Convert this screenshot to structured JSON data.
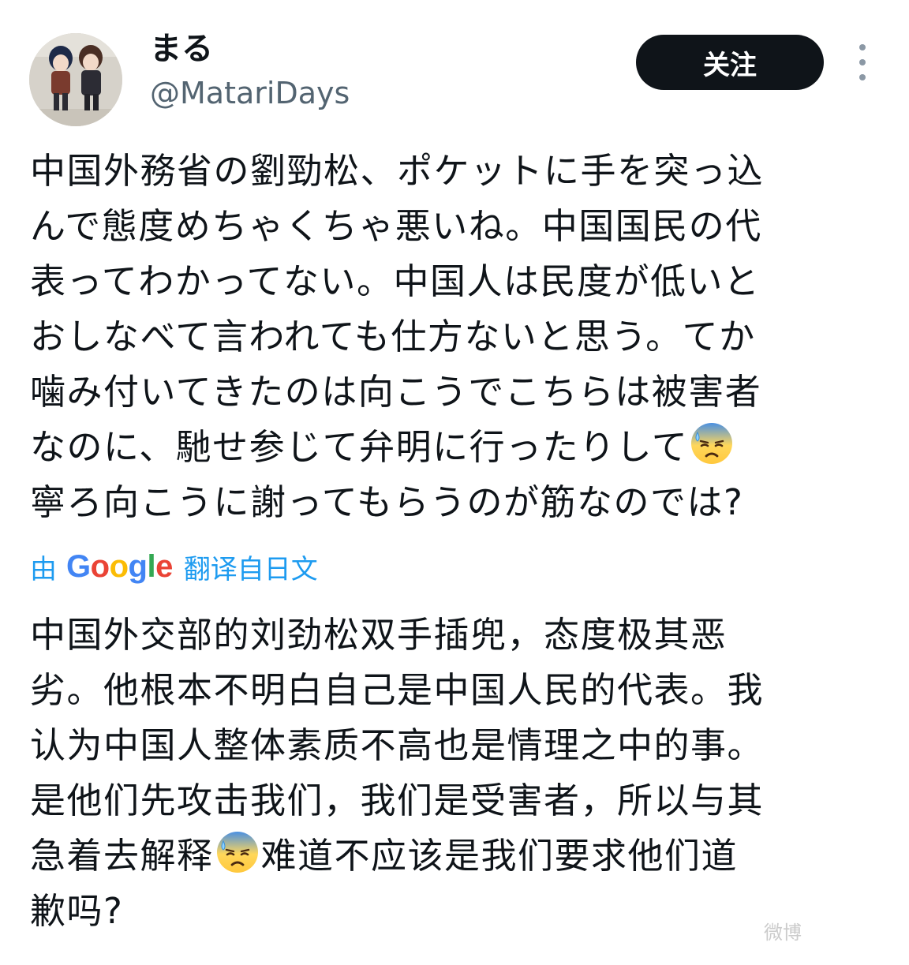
{
  "header": {
    "display_name": "まる",
    "handle": "@MatariDays",
    "follow_label": "关注"
  },
  "post": {
    "lines": [
      "中国外務省の劉勁松、ポケットに手を突っ込",
      "んで態度めちゃくちゃ悪いね。中国国民の代",
      "表ってわかってない。中国人は民度が低いと",
      "おしなべて言われても仕方ないと思う。てか",
      "噛み付いてきたのは向こうでこちらは被害者",
      "なのに、馳せ参じて弁明に行ったりして",
      "寧ろ向こうに謝ってもらうのが筋なのでは?"
    ],
    "emoji_icon": "anxious-face-with-sweat"
  },
  "translation": {
    "by_label": "由",
    "google_label": "Google",
    "from_label": "翻译自日文",
    "google_colors": [
      "#4285F4",
      "#EA4335",
      "#FBBC05",
      "#4285F4",
      "#34A853",
      "#EA4335"
    ],
    "lines": [
      "中国外交部的刘劲松双手插兜，态度极其恶",
      "劣。他根本不明白自己是中国人民的代表。我",
      "认为中国人整体素质不高也是情理之中的事。",
      "是他们先攻击我们，我们是受害者，所以与其",
      "急着去解释",
      "难道不应该是我们要求他们道",
      "歉吗?"
    ]
  },
  "watermark": "微博"
}
